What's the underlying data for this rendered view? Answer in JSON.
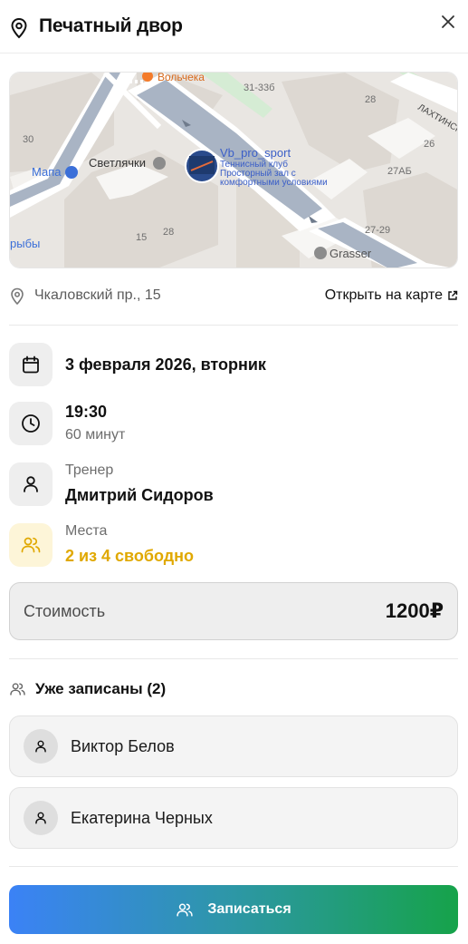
{
  "header": {
    "title": "Печатный двор"
  },
  "map": {
    "labels": {
      "volchek": "Вольчека",
      "n3133b": "31-33б",
      "n28a": "28",
      "lakhtinskaya": "ЛАХТИНСК",
      "n30": "30",
      "svetlyachki": "Светлячки",
      "n26": "26",
      "mama": "Мапа",
      "club_name": "Vb_pro_sport",
      "club_desc_1": "Теннисный клуб",
      "club_desc_2": "Просторный зал с",
      "club_desc_3": "комфортными условиями",
      "n27ab": "27АБ",
      "ryby": "рыбы",
      "n15": "15",
      "n28b": "28",
      "n2729": "27-29",
      "grasser": "Grasser"
    }
  },
  "address": {
    "text": "Чкаловский пр., 15",
    "open_link": "Открыть на карте"
  },
  "details": {
    "date": "3 февраля 2026, вторник",
    "time": "19:30",
    "duration": "60 минут",
    "coach_label": "Тренер",
    "coach_name": "Дмитрий Сидоров",
    "seats_label": "Места",
    "seats_value": "2 из 4 свободно",
    "seats_color": "#e0a800"
  },
  "price": {
    "label": "Стоимость",
    "value": "1200₽"
  },
  "enrolled": {
    "title": "Уже записаны (2)",
    "people": [
      {
        "name": "Виктор Белов"
      },
      {
        "name": "Екатерина Черных"
      }
    ]
  },
  "action": {
    "signup_label": "Записаться",
    "gradient_start": "#3b82f6",
    "gradient_end": "#16a34a"
  }
}
